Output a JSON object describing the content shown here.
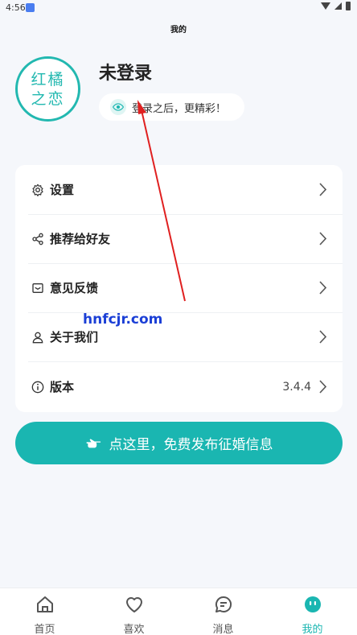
{
  "status_bar": {
    "time": "4:56"
  },
  "page": {
    "title": "我的"
  },
  "profile": {
    "avatar_logo_text": "红橘之恋",
    "login_title": "未登录",
    "login_hint": "登录之后，更精彩！"
  },
  "menu": {
    "items": [
      {
        "label": "设置",
        "icon": "gear-icon"
      },
      {
        "label": "推荐给好友",
        "icon": "share-icon"
      },
      {
        "label": "意见反馈",
        "icon": "feedback-icon"
      },
      {
        "label": "关于我们",
        "icon": "person-icon"
      },
      {
        "label": "版本",
        "icon": "info-icon",
        "value": "3.4.4"
      }
    ]
  },
  "watermark": "hnfcjr.com",
  "publish_button": {
    "label": "点这里，免费发布征婚信息"
  },
  "tab_bar": {
    "tabs": [
      {
        "label": "首页",
        "icon": "home-icon"
      },
      {
        "label": "喜欢",
        "icon": "heart-icon"
      },
      {
        "label": "消息",
        "icon": "message-icon"
      },
      {
        "label": "我的",
        "icon": "profile-icon",
        "active": true
      }
    ]
  },
  "colors": {
    "accent": "#1ab6b1",
    "annotation": "#e02020",
    "watermark": "#1b3fd6"
  }
}
